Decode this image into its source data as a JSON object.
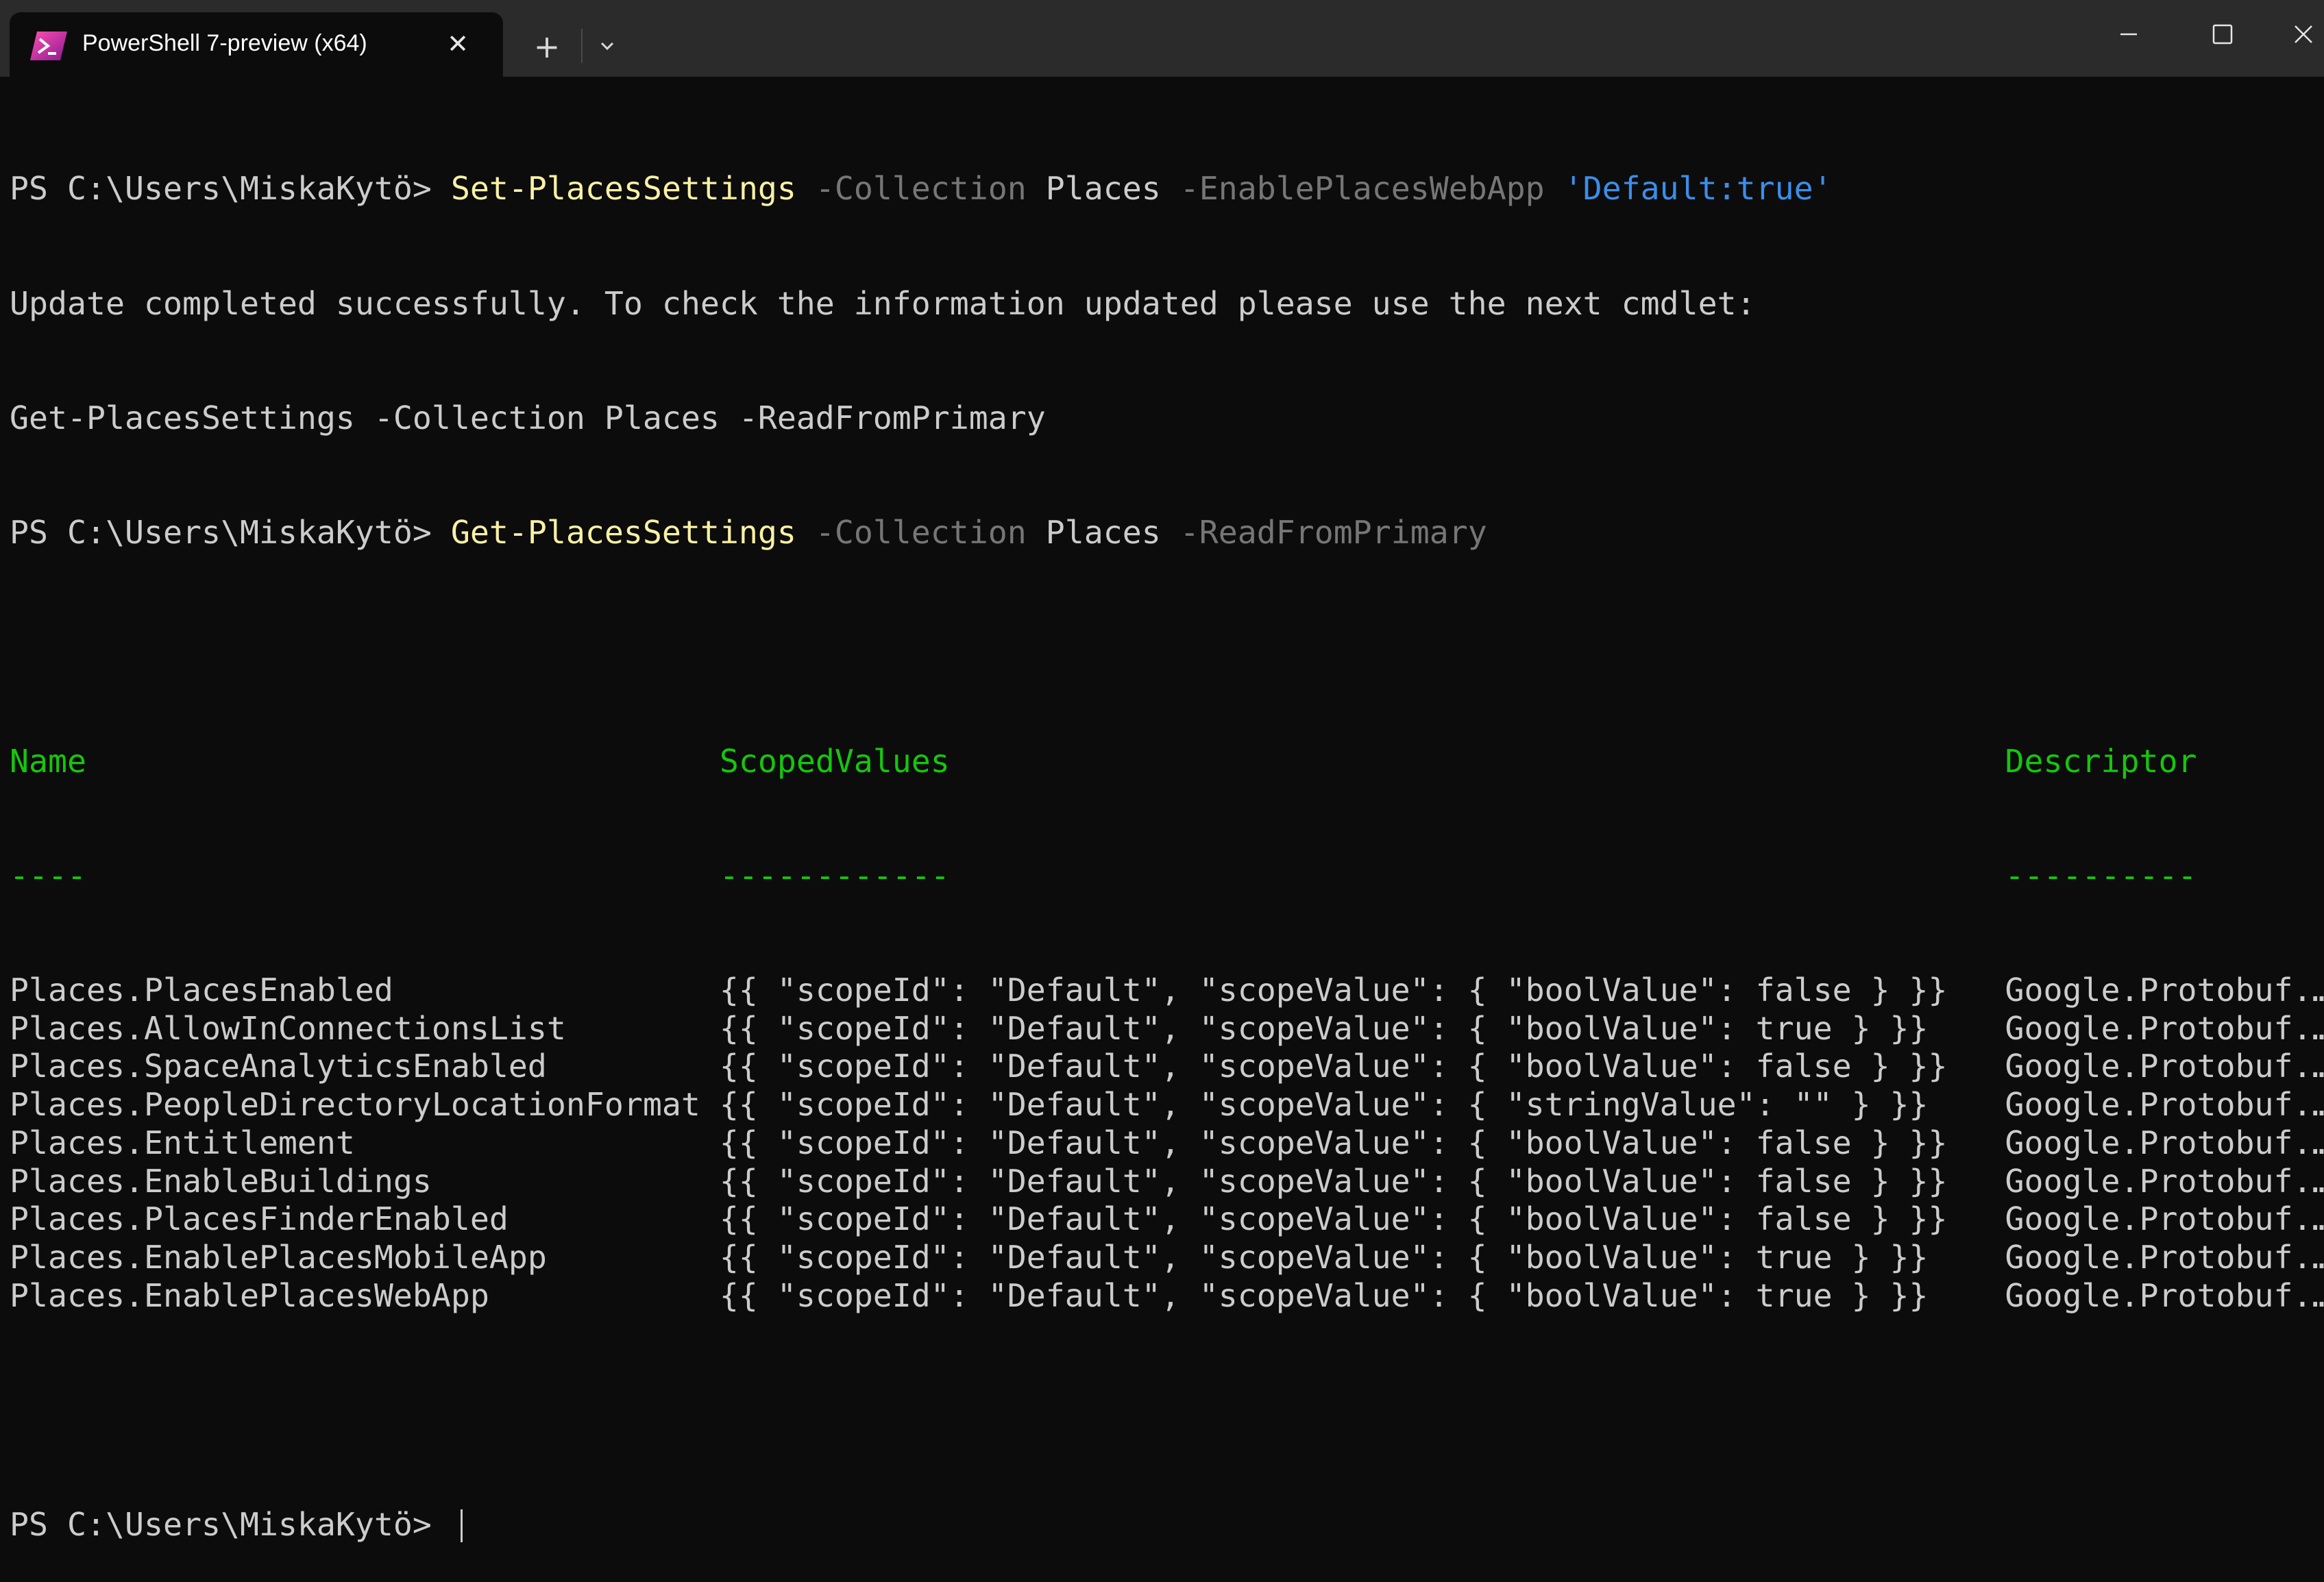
{
  "window": {
    "tab_title": "PowerShell 7-preview (x64)",
    "tab_close_glyph": "✕",
    "new_tab_glyph": "+",
    "icons": [
      "powershell-icon",
      "close-icon",
      "plus-icon",
      "chevron-down-icon",
      "minimize-icon",
      "maximize-icon",
      "close-window-icon"
    ]
  },
  "terminal": {
    "prompt": "PS C:\\Users\\MiskaKytö> ",
    "cmd1": {
      "name": "Set-PlacesSettings",
      "p1": "-Collection",
      "v1": "Places",
      "p2": "-EnablePlacesWebApp",
      "v2": "'Default:true'"
    },
    "out1": "Update completed successfully. To check the information updated please use the next cmdlet:",
    "out2": "Get-PlacesSettings -Collection Places -ReadFromPrimary",
    "cmd2": {
      "name": "Get-PlacesSettings",
      "p1": "-Collection",
      "v1": "Places",
      "p2": "-ReadFromPrimary"
    },
    "table": {
      "headers": [
        "Name",
        "ScopedValues",
        "Descriptor"
      ],
      "underlines": [
        "----",
        "------------",
        "----------"
      ],
      "rows": [
        [
          "Places.PlacesEnabled",
          "{{ \"scopeId\": \"Default\", \"scopeValue\": { \"boolValue\": false } }}",
          "Google.Protobuf.…"
        ],
        [
          "Places.AllowInConnectionsList",
          "{{ \"scopeId\": \"Default\", \"scopeValue\": { \"boolValue\": true } }}",
          "Google.Protobuf.…"
        ],
        [
          "Places.SpaceAnalyticsEnabled",
          "{{ \"scopeId\": \"Default\", \"scopeValue\": { \"boolValue\": false } }}",
          "Google.Protobuf.…"
        ],
        [
          "Places.PeopleDirectoryLocationFormat",
          "{{ \"scopeId\": \"Default\", \"scopeValue\": { \"stringValue\": \"\" } }}",
          "Google.Protobuf.…"
        ],
        [
          "Places.Entitlement",
          "{{ \"scopeId\": \"Default\", \"scopeValue\": { \"boolValue\": false } }}",
          "Google.Protobuf.…"
        ],
        [
          "Places.EnableBuildings",
          "{{ \"scopeId\": \"Default\", \"scopeValue\": { \"boolValue\": false } }}",
          "Google.Protobuf.…"
        ],
        [
          "Places.PlacesFinderEnabled",
          "{{ \"scopeId\": \"Default\", \"scopeValue\": { \"boolValue\": false } }}",
          "Google.Protobuf.…"
        ],
        [
          "Places.EnablePlacesMobileApp",
          "{{ \"scopeId\": \"Default\", \"scopeValue\": { \"boolValue\": true } }}",
          "Google.Protobuf.…"
        ],
        [
          "Places.EnablePlacesWebApp",
          "{{ \"scopeId\": \"Default\", \"scopeValue\": { \"boolValue\": true } }}",
          "Google.Protobuf.…"
        ]
      ]
    }
  },
  "colors": {
    "background": "#0c0c0c",
    "titlebar": "#2b2b2b",
    "text": "#cccccc",
    "cmdlet": "#f9f1a5",
    "parameter": "#767676",
    "string": "#3b8eea",
    "header": "#16c60c"
  }
}
